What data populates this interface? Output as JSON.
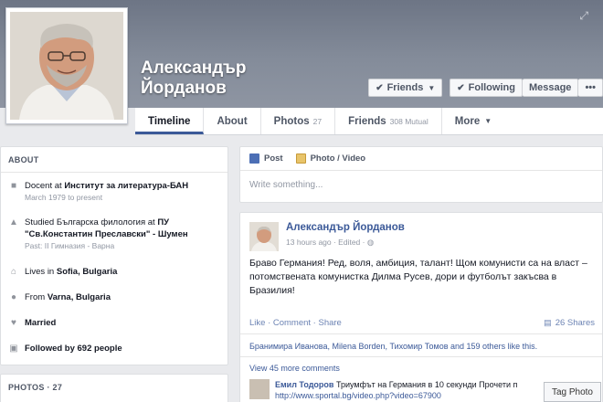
{
  "profile": {
    "name_line1": "Александър",
    "name_line2": "Йорданов"
  },
  "cover_buttons": {
    "friends": "Friends",
    "following": "Following",
    "message": "Message"
  },
  "nav": {
    "timeline": "Timeline",
    "about": "About",
    "photos": "Photos",
    "photos_count": "27",
    "friends": "Friends",
    "friends_count": "308 Mutual",
    "more": "More"
  },
  "about": {
    "header": "ABOUT",
    "items": [
      {
        "icon": "briefcase-icon",
        "prefix": "Docent at ",
        "bold": "Институт за литература-БАН",
        "sub": "March 1979 to present"
      },
      {
        "icon": "graduation-cap-icon",
        "prefix": "Studied Българска филология at ",
        "bold": "ПУ \"Св.Константин Преславски\" - Шумен",
        "sub": "Past: II Гимназия - Варна"
      },
      {
        "icon": "house-icon",
        "prefix": "Lives in ",
        "bold": "Sofia, Bulgaria",
        "sub": ""
      },
      {
        "icon": "map-pin-icon",
        "prefix": "From ",
        "bold": "Varna, Bulgaria",
        "sub": ""
      },
      {
        "icon": "heart-icon",
        "prefix": "",
        "bold": "Married",
        "sub": ""
      },
      {
        "icon": "rss-icon",
        "prefix": "",
        "bold": "Followed by 692 people",
        "sub": ""
      }
    ]
  },
  "photos_card": {
    "header": "PHOTOS · 27"
  },
  "composer": {
    "post_tab": "Post",
    "photo_tab": "Photo / Video",
    "placeholder": "Write something..."
  },
  "post": {
    "author": "Александър Йорданов",
    "meta": "13 hours ago · Edited · ",
    "text": "Браво Германия! Ред, воля, амбиция, талант! Щом комунисти са на власт – потомствената комунистка Дилма Русев, дори и футболът закъсва в Бразилия!",
    "actions": "Like · Comment · Share",
    "shares": "26 Shares",
    "likes": "Бранимира Иванова, Milena Borden, Тихомир Томов and 159 others like this.",
    "view_more": "View 45 more comments",
    "comment_author": "Емил Тодоров",
    "comment_text": " Триумфът на Германия в 10 секунди Прочети п",
    "comment_link": "http://www.sportal.bg/video.php?video=67900"
  },
  "tag_photo": "Tag Photo",
  "colors": {
    "link_blue": "#3b5998",
    "cover": "#848c9a",
    "background": "#e9eaed"
  }
}
